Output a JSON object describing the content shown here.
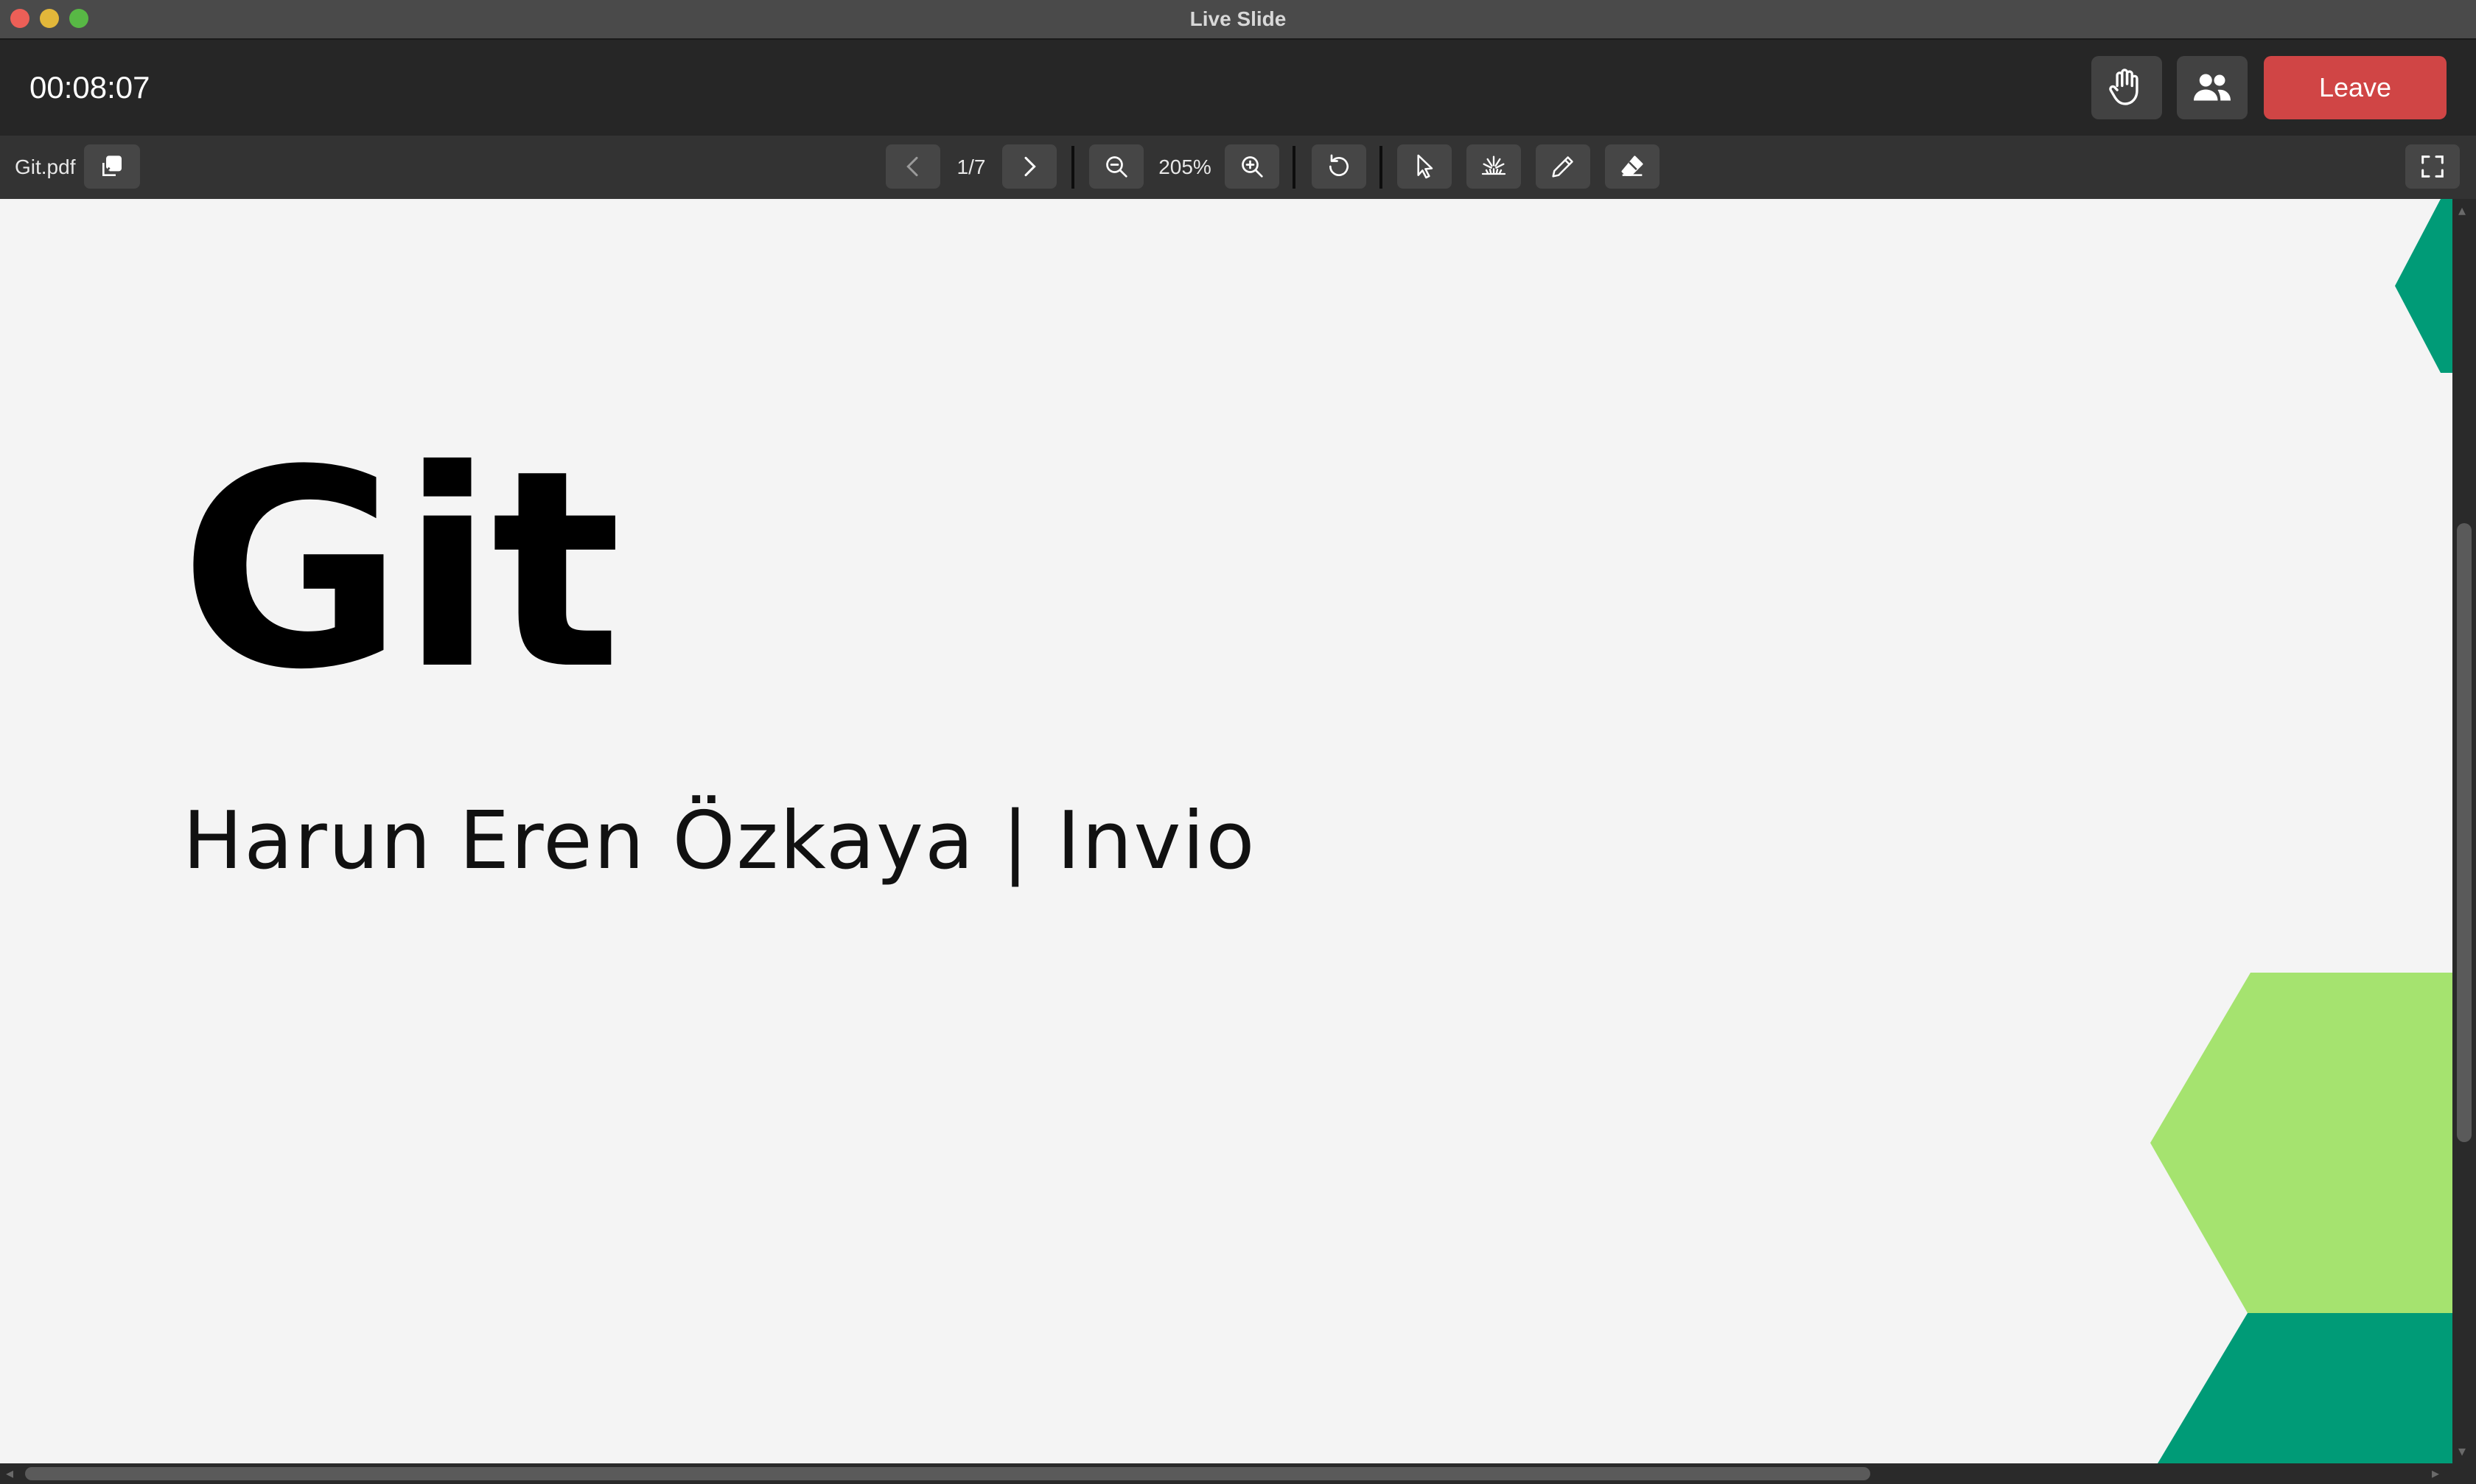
{
  "window": {
    "title": "Live Slide"
  },
  "topbar": {
    "timer": "00:08:07",
    "raise_hand_icon": "hand-icon",
    "participants_icon": "people-icon",
    "leave_label": "Leave"
  },
  "toolbar": {
    "file_name": "Git.pdf",
    "page_indicator": "1/7",
    "zoom_level": "205%",
    "icons": [
      "duplicate-icon",
      "chevron-left-icon",
      "chevron-right-icon",
      "zoom-out-icon",
      "zoom-in-icon",
      "rotate-icon",
      "pointer-icon",
      "laser-icon",
      "pencil-icon",
      "eraser-icon",
      "fullscreen-icon"
    ]
  },
  "slide": {
    "title": "Git",
    "subtitle": "Harun Eren Özkaya | Invio",
    "colors": {
      "background": "#f4f4f4",
      "dark_green": "#009b77",
      "light_green": "#a5e36f"
    }
  },
  "colors": {
    "leave_button": "#d04545",
    "topbar": "#262626",
    "toolbar": "#333333"
  }
}
